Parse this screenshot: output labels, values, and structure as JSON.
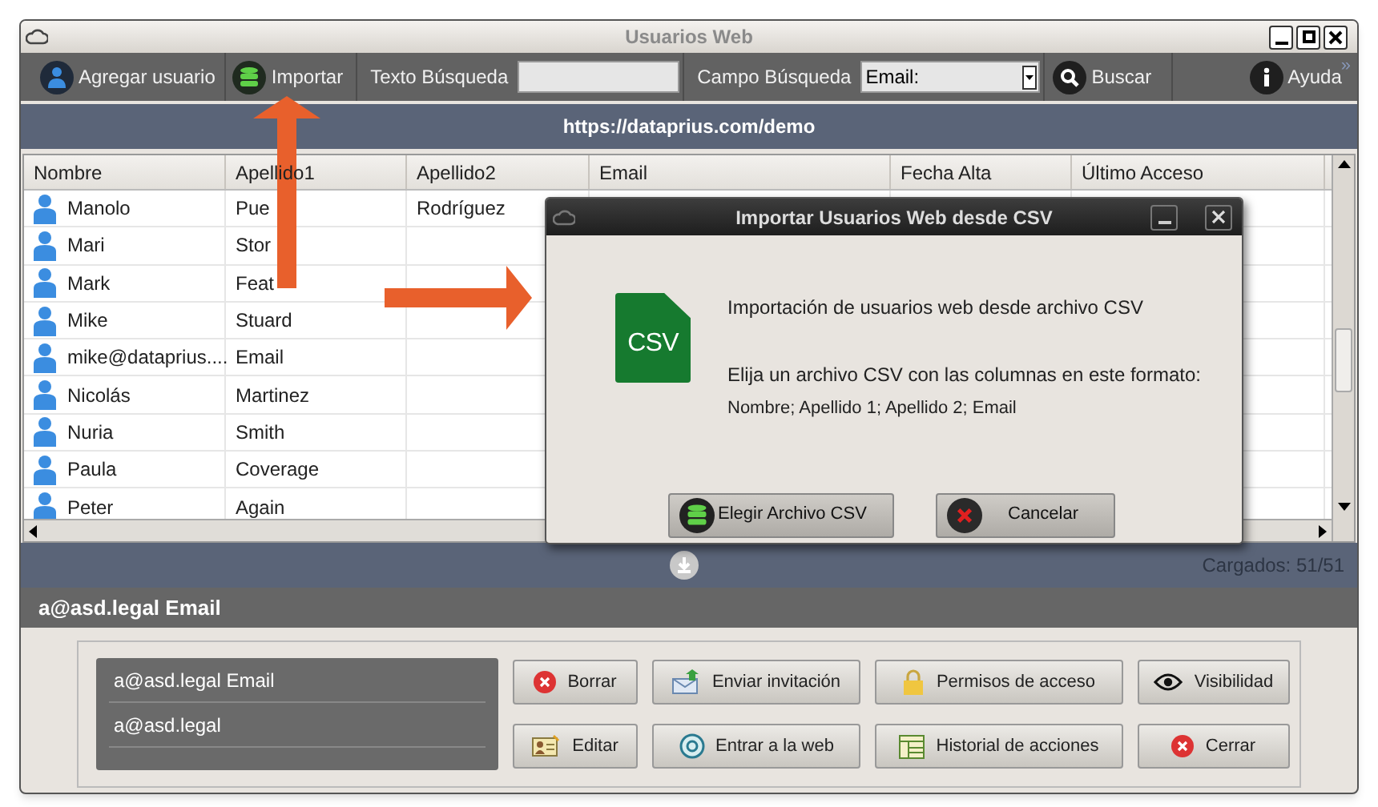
{
  "window": {
    "title": "Usuarios Web"
  },
  "toolbar": [
    {
      "kind": "add",
      "label": "Agregar usuario"
    },
    {
      "kind": "import",
      "label": "Importar"
    },
    {
      "kind": "field",
      "label": "Texto Búsqueda"
    },
    {
      "kind": "select",
      "label": "Campo Búsqueda",
      "value": "Email:"
    },
    {
      "kind": "search",
      "label": "Buscar"
    },
    {
      "kind": "help",
      "label": "Ayuda"
    }
  ],
  "toolbar_overflow": "»",
  "url": "https://dataprius.com/demo",
  "table": {
    "columns": [
      "Nombre",
      "Apellido1",
      "Apellido2",
      "Email",
      "Fecha Alta",
      "Último Acceso"
    ],
    "rows": [
      {
        "cells": [
          "Manolo",
          "Pue",
          "Rodríguez"
        ]
      },
      {
        "cells": [
          "Mari",
          "Stor",
          ""
        ]
      },
      {
        "cells": [
          "Mark",
          "Feat",
          ""
        ]
      },
      {
        "cells": [
          "Mike",
          "Stuard",
          ""
        ]
      },
      {
        "cells": [
          "mike@dataprius....",
          "Email",
          ""
        ]
      },
      {
        "cells": [
          "Nicolás",
          "Martinez",
          ""
        ]
      },
      {
        "cells": [
          "Nuria",
          "Smith",
          ""
        ]
      },
      {
        "cells": [
          "Paula",
          "Coverage",
          ""
        ]
      },
      {
        "cells": [
          "Peter",
          "Again",
          ""
        ]
      }
    ]
  },
  "status": "Cargados: 51/51",
  "detail_title": "a@asd.legal Email",
  "detail_list": [
    "a@asd.legal Email",
    "a@asd.legal"
  ],
  "actions": [
    {
      "kind": "delete",
      "label": "Borrar"
    },
    {
      "kind": "invite",
      "label": "Enviar invitación"
    },
    {
      "kind": "permissions",
      "label": "Permisos de acceso"
    },
    {
      "kind": "visibility",
      "label": "Visibilidad"
    },
    {
      "kind": "edit",
      "label": "Editar"
    },
    {
      "kind": "web",
      "label": "Entrar a la web"
    },
    {
      "kind": "history",
      "label": "Historial de acciones"
    },
    {
      "kind": "close",
      "label": "Cerrar"
    }
  ],
  "dialog": {
    "title": "Importar Usuarios Web desde CSV",
    "icon_label": "CSV",
    "heading": "Importación de usuarios web desde archivo CSV",
    "instruction": "Elija un archivo CSV con las columnas en este formato:",
    "format": "Nombre; Apellido 1; Apellido 2; Email",
    "buttons": [
      {
        "kind": "choose",
        "label": "Elegir Archivo CSV"
      },
      {
        "kind": "cancel",
        "label": "Cancelar"
      }
    ]
  }
}
